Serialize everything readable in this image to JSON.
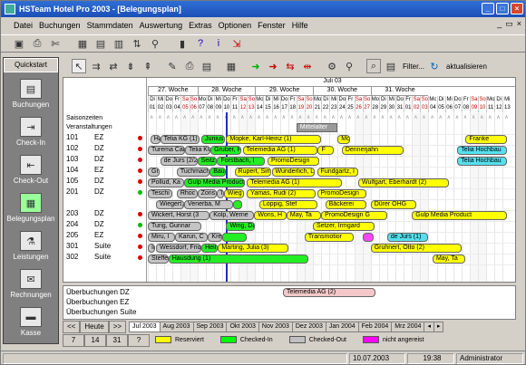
{
  "window": {
    "title": "HSTeam Hotel Pro 2003 - [Belegungsplan]"
  },
  "menu": [
    "Datei",
    "Buchungen",
    "Stammdaten",
    "Auswertung",
    "Extras",
    "Optionen",
    "Fenster",
    "Hilfe"
  ],
  "sidebar": {
    "header": "Quickstart",
    "items": [
      {
        "label": "Buchungen",
        "icon": "book-icon"
      },
      {
        "label": "Check-In",
        "icon": "check-in-icon"
      },
      {
        "label": "Check-Out",
        "icon": "check-out-icon"
      },
      {
        "label": "Belegungsplan",
        "icon": "calendar-icon"
      },
      {
        "label": "Leistungen",
        "icon": "services-icon"
      },
      {
        "label": "Rechnungen",
        "icon": "invoice-icon"
      },
      {
        "label": "Kasse",
        "icon": "cash-register-icon"
      }
    ]
  },
  "toolbar2": {
    "filter_label": "Filter...",
    "refresh_label": "aktualisieren"
  },
  "plan": {
    "month": "Juli 03",
    "weeks": [
      "27. Woche",
      "28. Woche",
      "29. Woche",
      "30. Woche",
      "31. Woche"
    ],
    "days": [
      {
        "d": "Di",
        "n": "01"
      },
      {
        "d": "Mi",
        "n": "02"
      },
      {
        "d": "Do",
        "n": "03"
      },
      {
        "d": "Fr",
        "n": "04"
      },
      {
        "d": "Sa",
        "n": "05"
      },
      {
        "d": "So",
        "n": "06"
      },
      {
        "d": "Mo",
        "n": "07"
      },
      {
        "d": "Di",
        "n": "08"
      },
      {
        "d": "Mi",
        "n": "09"
      },
      {
        "d": "Do",
        "n": "10"
      },
      {
        "d": "Fr",
        "n": "11"
      },
      {
        "d": "Sa",
        "n": "12"
      },
      {
        "d": "So",
        "n": "13"
      },
      {
        "d": "Mo",
        "n": "14"
      },
      {
        "d": "Di",
        "n": "15"
      },
      {
        "d": "Mi",
        "n": "16"
      },
      {
        "d": "Do",
        "n": "17"
      },
      {
        "d": "Fr",
        "n": "18"
      },
      {
        "d": "Sa",
        "n": "19"
      },
      {
        "d": "So",
        "n": "20"
      },
      {
        "d": "Mo",
        "n": "21"
      },
      {
        "d": "Di",
        "n": "22"
      },
      {
        "d": "Mi",
        "n": "23"
      },
      {
        "d": "Do",
        "n": "24"
      },
      {
        "d": "Fr",
        "n": "25"
      },
      {
        "d": "Sa",
        "n": "26"
      },
      {
        "d": "So",
        "n": "27"
      },
      {
        "d": "Mo",
        "n": "28"
      },
      {
        "d": "Di",
        "n": "29"
      },
      {
        "d": "Mi",
        "n": "30"
      },
      {
        "d": "Do",
        "n": "31"
      },
      {
        "d": "Fr",
        "n": "01"
      },
      {
        "d": "Sa",
        "n": "02"
      },
      {
        "d": "So",
        "n": "03"
      },
      {
        "d": "Mo",
        "n": "04"
      },
      {
        "d": "Di",
        "n": "05"
      },
      {
        "d": "Mi",
        "n": "06"
      },
      {
        "d": "Do",
        "n": "07"
      },
      {
        "d": "Fr",
        "n": "08"
      },
      {
        "d": "Sa",
        "n": "09"
      },
      {
        "d": "So",
        "n": "10"
      },
      {
        "d": "Mo",
        "n": "11"
      },
      {
        "d": "Di",
        "n": "12"
      },
      {
        "d": "Mi",
        "n": "13"
      }
    ],
    "header_rows": [
      "Saisonzeiten",
      "Veranstaltungen"
    ],
    "event": "Mittelalter",
    "rooms": [
      {
        "nr": "101",
        "type": "EZ",
        "dot": "red"
      },
      {
        "nr": "102",
        "type": "DZ",
        "dot": "red"
      },
      {
        "nr": "103",
        "type": "DZ",
        "dot": "red"
      },
      {
        "nr": "104",
        "type": "EZ",
        "dot": "red"
      },
      {
        "nr": "105",
        "type": "DZ",
        "dot": "red"
      },
      {
        "nr": "201",
        "type": "DZ",
        "dot": "green"
      },
      {
        "nr": "203",
        "type": "DZ",
        "dot": "red"
      },
      {
        "nr": "204",
        "type": "DZ",
        "dot": "green"
      },
      {
        "nr": "205",
        "type": "EZ",
        "dot": "red"
      },
      {
        "nr": "301",
        "type": "Suite",
        "dot": "red"
      },
      {
        "nr": "302",
        "type": "Suite",
        "dot": "red"
      }
    ],
    "bookings": [
      {
        "row": 0,
        "s": 0.3,
        "e": 1.5,
        "t": "Hatz",
        "st": "out"
      },
      {
        "row": 0,
        "s": 1.5,
        "e": 6.3,
        "t": "Telia KG (1)",
        "st": "out"
      },
      {
        "row": 0,
        "s": 6.5,
        "e": 9.3,
        "t": "Junius, Pet",
        "st": "in"
      },
      {
        "row": 0,
        "s": 9.5,
        "e": 21,
        "t": "Mopke, Karl-Heinz (1)",
        "st": "res"
      },
      {
        "row": 0,
        "s": 23,
        "e": 24.5,
        "t": "Mopke",
        "st": "res"
      },
      {
        "row": 0,
        "s": 38.5,
        "e": 43.5,
        "t": "Franke",
        "st": "res"
      },
      {
        "row": 1,
        "s": 0,
        "e": 4.5,
        "t": "Turema Cargo",
        "st": "out"
      },
      {
        "row": 1,
        "s": 4.5,
        "e": 7.6,
        "t": "Telia KG (1)",
        "st": "out"
      },
      {
        "row": 1,
        "s": 7.6,
        "e": 11.3,
        "t": "Gruber, Fran",
        "st": "in"
      },
      {
        "row": 1,
        "s": 11.5,
        "e": 20.5,
        "t": "Telemedia AG (1)",
        "st": "res"
      },
      {
        "row": 1,
        "s": 20.6,
        "e": 22.5,
        "t": "F",
        "st": "res"
      },
      {
        "row": 1,
        "s": 23.5,
        "e": 31,
        "t": "Dennerjahn",
        "st": "res"
      },
      {
        "row": 1,
        "s": 37.5,
        "e": 43.5,
        "t": "Telia Hochbau",
        "st": "cyan"
      },
      {
        "row": 2,
        "s": 1.5,
        "e": 6,
        "t": "de Jurs (2/2)",
        "st": "out"
      },
      {
        "row": 2,
        "s": 6,
        "e": 8.4,
        "t": "Seitz, A",
        "st": "in"
      },
      {
        "row": 2,
        "s": 8.4,
        "e": 14.2,
        "t": "Forstbach, I",
        "st": "in"
      },
      {
        "row": 2,
        "s": 14.5,
        "e": 20.8,
        "t": "PromoDesign",
        "st": "res"
      },
      {
        "row": 2,
        "s": 37.5,
        "e": 43.5,
        "t": "Telia Hochbau",
        "st": "cyan"
      },
      {
        "row": 3,
        "s": 0,
        "e": 1.4,
        "t": "Gri",
        "st": "out"
      },
      {
        "row": 3,
        "s": 3.5,
        "e": 7.5,
        "t": "Tuchmacher",
        "st": "out"
      },
      {
        "row": 3,
        "s": 7.5,
        "e": 9.5,
        "t": "Bauer",
        "st": "in"
      },
      {
        "row": 3,
        "s": 10.5,
        "e": 15,
        "t": "Rupert, Sim",
        "st": "res"
      },
      {
        "row": 3,
        "s": 15,
        "e": 20.2,
        "t": "Wunderlich, L",
        "st": "res"
      },
      {
        "row": 3,
        "s": 20.5,
        "e": 25.5,
        "t": "Fundgartz, I",
        "st": "res"
      },
      {
        "row": 4,
        "s": 0,
        "e": 4.4,
        "t": "Pollud, Ka",
        "st": "out"
      },
      {
        "row": 4,
        "s": 4.4,
        "e": 11.8,
        "t": "Gulp Media Production",
        "st": "in"
      },
      {
        "row": 4,
        "s": 12,
        "e": 23.5,
        "t": "Telemedia AG (1)",
        "st": "res"
      },
      {
        "row": 4,
        "s": 25.5,
        "e": 36.5,
        "t": "Wulfgart, Eberhardt (2)",
        "st": "res"
      },
      {
        "row": 5,
        "s": 0,
        "e": 3,
        "t": "Teschi",
        "st": "out"
      },
      {
        "row": 5,
        "s": 3.5,
        "e": 6,
        "t": "Rhoc",
        "st": "out"
      },
      {
        "row": 5,
        "s": 6,
        "e": 8.3,
        "t": "Zons",
        "st": "out"
      },
      {
        "row": 5,
        "s": 8.3,
        "e": 9.2,
        "t": "T",
        "st": "out"
      },
      {
        "row": 5,
        "s": 9.2,
        "e": 11.6,
        "t": "Wieg",
        "st": "res"
      },
      {
        "row": 5,
        "s": 12,
        "e": 20.3,
        "t": "Yamas, Rudi (2)",
        "st": "res"
      },
      {
        "row": 5,
        "s": 20.5,
        "e": 26.5,
        "t": "PromoDesign",
        "st": "res"
      },
      {
        "row": 6,
        "s": 1,
        "e": 4.4,
        "t": "Wiegert, He",
        "st": "out"
      },
      {
        "row": 6,
        "s": 4.4,
        "e": 10.3,
        "t": "Venerba, M",
        "st": "out"
      },
      {
        "row": 6,
        "s": 10.3,
        "e": 11.4,
        "t": "",
        "st": "in"
      },
      {
        "row": 6,
        "s": 13.5,
        "e": 20.5,
        "t": "Loppig, Stef",
        "st": "res"
      },
      {
        "row": 6,
        "s": 21.5,
        "e": 26.5,
        "t": "Bäckerei",
        "st": "res"
      },
      {
        "row": 6,
        "s": 27,
        "e": 32.5,
        "t": "Dürer OHG",
        "st": "res"
      },
      {
        "row": 7,
        "s": 0,
        "e": 7.5,
        "t": "Wickert, Horst (3",
        "st": "out"
      },
      {
        "row": 7,
        "s": 7.5,
        "e": 12.9,
        "t": "Kolp, Werne",
        "st": "out"
      },
      {
        "row": 7,
        "s": 12.9,
        "e": 16.8,
        "t": "Wons, H",
        "st": "res"
      },
      {
        "row": 7,
        "s": 16.8,
        "e": 21,
        "t": "May, Ta",
        "st": "res"
      },
      {
        "row": 7,
        "s": 21,
        "e": 29,
        "t": "PromoDesign G",
        "st": "res"
      },
      {
        "row": 7,
        "s": 32,
        "e": 43.5,
        "t": "Gulp Media Product",
        "st": "res"
      },
      {
        "row": 8,
        "s": 0,
        "e": 6.5,
        "t": "Turig, Gunnar",
        "st": "out"
      },
      {
        "row": 8,
        "s": 9.5,
        "e": 13,
        "t": "Wing, Da",
        "st": "in"
      },
      {
        "row": 8,
        "s": 20,
        "e": 27.5,
        "t": "Setzer, Irmgard",
        "st": "res"
      },
      {
        "row": 9,
        "s": 0,
        "e": 3.3,
        "t": "Miru, I",
        "st": "out"
      },
      {
        "row": 9,
        "s": 3.3,
        "e": 7.3,
        "t": "Karun, C",
        "st": "out"
      },
      {
        "row": 9,
        "s": 7.3,
        "e": 9,
        "t": "Krev",
        "st": "out"
      },
      {
        "row": 9,
        "s": 9,
        "e": 12,
        "t": "",
        "st": "in"
      },
      {
        "row": 9,
        "s": 19,
        "e": 25,
        "t": "Transmotior",
        "st": "res"
      },
      {
        "row": 9,
        "s": 26,
        "e": 27.4,
        "t": "",
        "st": "pink"
      },
      {
        "row": 9,
        "s": 29,
        "e": 34,
        "t": "de Jurs (1)",
        "st": "cyan"
      },
      {
        "row": 10,
        "s": 0,
        "e": 0.9,
        "t": "Ir",
        "st": "out"
      },
      {
        "row": 10,
        "s": 1,
        "e": 6.5,
        "t": "Wessdorf, Fridt",
        "st": "out"
      },
      {
        "row": 10,
        "s": 6.5,
        "e": 8.5,
        "t": "Heil",
        "st": "in"
      },
      {
        "row": 10,
        "s": 8.5,
        "e": 17,
        "t": "Marting, Julia (3)",
        "st": "res"
      },
      {
        "row": 10,
        "s": 27,
        "e": 38,
        "t": "Gruhnert, Otto (2)",
        "st": "res"
      },
      {
        "row": 11,
        "s": 0,
        "e": 2.5,
        "t": "Steffe",
        "st": "out"
      },
      {
        "row": 11,
        "s": 2.5,
        "e": 19.5,
        "t": "Hausdung (1)",
        "st": "in"
      },
      {
        "row": 11,
        "s": 34.5,
        "e": 38.5,
        "t": "May, Ta",
        "st": "res"
      }
    ],
    "overbooking": [
      {
        "label": "Überbuchungen DZ"
      },
      {
        "label": "Überbuchungen EZ"
      },
      {
        "label": "Überbuchungen Suite"
      }
    ],
    "overbooking_bar": {
      "t": "Telemedia AG (2)"
    }
  },
  "nav": {
    "prev": "<<",
    "today": "Heute",
    "next": ">>",
    "n7": "7",
    "n14": "14",
    "n31": "31",
    "help": "?",
    "months": [
      "Jul 2003",
      "Aug 2003",
      "Sep 2003",
      "Okt 2003",
      "Nov 2003",
      "Dez 2003",
      "Jan 2004",
      "Feb 2004",
      "Mrz 2004"
    ]
  },
  "legend": [
    {
      "label": "Reserviert",
      "color": "#ffff00"
    },
    {
      "label": "Checked-In",
      "color": "#00ff00"
    },
    {
      "label": "Checked-Out",
      "color": "#c0c0c0"
    },
    {
      "label": "nicht angereist",
      "color": "#ff00ff"
    }
  ],
  "status": {
    "date": "10.07.2003",
    "time": "19:38",
    "user": "Administrator"
  },
  "colors": {
    "res": "#ffff00",
    "in": "#22ee22",
    "out": "#c4c4c4",
    "cyan": "#55e0ee",
    "pink": "#ff44ff"
  }
}
